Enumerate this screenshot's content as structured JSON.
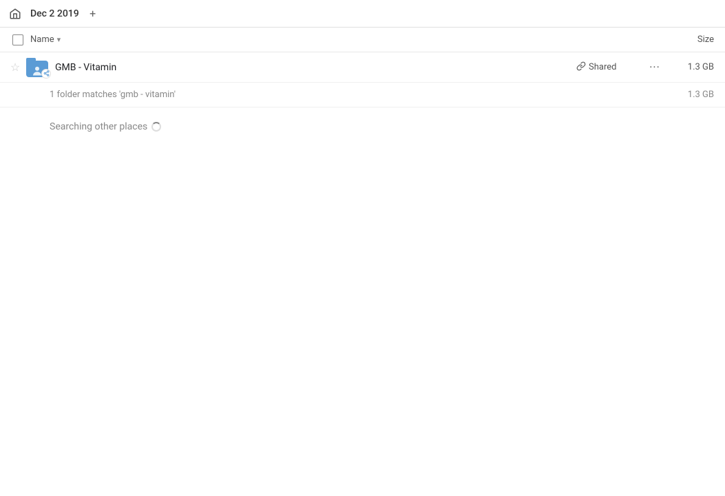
{
  "topbar": {
    "breadcrumb": "Dec 2 2019",
    "add_tab_label": "+"
  },
  "columns": {
    "name_label": "Name",
    "size_label": "Size"
  },
  "file_row": {
    "name": "GMB - Vitamin",
    "shared_label": "Shared",
    "size": "1.3 GB",
    "more_label": "···"
  },
  "match_info": {
    "text": "1 folder matches 'gmb - vitamin'",
    "size": "1.3 GB"
  },
  "searching": {
    "label": "Searching other places"
  },
  "icons": {
    "home": "🏠",
    "star_empty": "☆",
    "link": "🔗",
    "more": "•••"
  },
  "colors": {
    "folder_blue": "#5b9bd5",
    "accent": "#1a73e8"
  }
}
